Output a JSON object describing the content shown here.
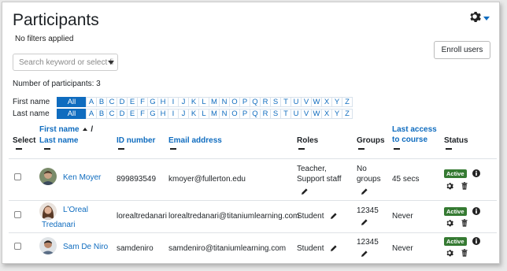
{
  "page": {
    "title": "Participants",
    "filter_status": "No filters applied",
    "enroll_label": "Enroll users",
    "search_placeholder": "Search keyword or select fi",
    "participant_count": "Number of participants: 3"
  },
  "initials_bar": {
    "first_name_label": "First name",
    "last_name_label": "Last name",
    "all_label": "All",
    "letters": [
      "A",
      "B",
      "C",
      "D",
      "E",
      "F",
      "G",
      "H",
      "I",
      "J",
      "K",
      "L",
      "M",
      "N",
      "O",
      "P",
      "Q",
      "R",
      "S",
      "T",
      "U",
      "V",
      "W",
      "X",
      "Y",
      "Z"
    ]
  },
  "table": {
    "headers": {
      "select": "Select",
      "first_name": "First name",
      "slash": "/",
      "last_name": "Last name",
      "id_number": "ID number",
      "email": "Email address",
      "roles": "Roles",
      "groups": "Groups",
      "last_access_1": "Last access",
      "last_access_2": "to course",
      "status": "Status"
    },
    "rows": [
      {
        "name_1": "Ken Moyer",
        "name_2": "",
        "id_number": "899893549",
        "email": "kmoyer@fullerton.edu",
        "roles_1": "Teacher,",
        "roles_2": "Support staff",
        "groups_1": "No",
        "groups_2": "groups",
        "last_access": "45 secs",
        "status": "Active"
      },
      {
        "name_1": "L'Oreal",
        "name_2": "Tredanari",
        "id_number": "lorealtredanari",
        "email": "lorealtredanari@titaniumlearning.com",
        "roles_1": "Student",
        "roles_2": "",
        "groups_1": "12345",
        "groups_2": "",
        "last_access": "Never",
        "status": "Active"
      },
      {
        "name_1": "Sam De Niro",
        "name_2": "",
        "id_number": "samdeniro",
        "email": "samdeniro@titaniumlearning.com",
        "roles_1": "Student",
        "roles_2": "",
        "groups_1": "12345",
        "groups_2": "",
        "last_access": "Never",
        "status": "Active"
      }
    ]
  },
  "colors": {
    "link": "#0f6cbf",
    "active_badge": "#357a32",
    "text": "#1d2125"
  },
  "icons": {
    "settings": "gear-icon",
    "edit": "pencil-icon",
    "info": "info-icon",
    "delete": "trash-icon",
    "sort": "sort-ascending-icon"
  }
}
